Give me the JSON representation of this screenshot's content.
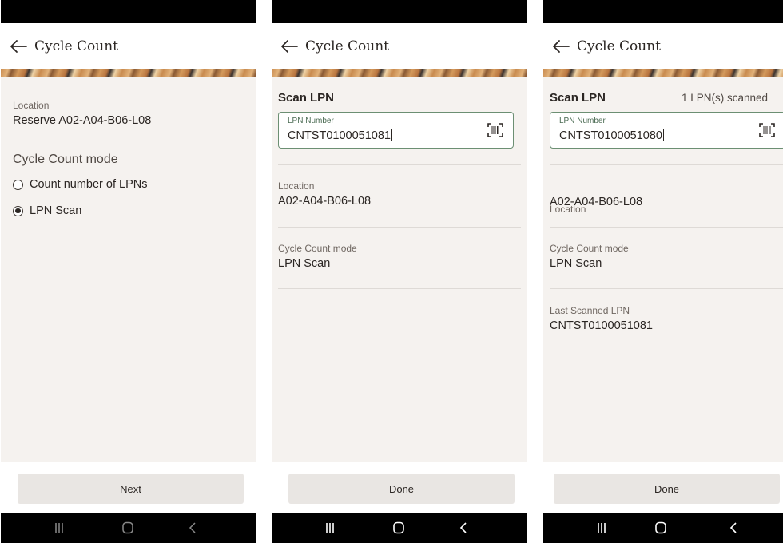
{
  "header": {
    "title": "Cycle Count"
  },
  "screens": {
    "mode_select": {
      "location_label": "Location",
      "location_value": "Reserve A02-A04-B06-L08",
      "mode_heading": "Cycle Count mode",
      "options": [
        {
          "label": "Count number of LPNs",
          "selected": false
        },
        {
          "label": "LPN Scan",
          "selected": true
        }
      ],
      "footer_button": "Next"
    },
    "scan_first": {
      "scan_title": "Scan LPN",
      "lpn_label": "LPN Number",
      "lpn_value": "CNTST0100051081",
      "location_label": "Location",
      "location_value": "A02-A04-B06-L08",
      "mode_label": "Cycle Count mode",
      "mode_value": "LPN Scan",
      "footer_button": "Done"
    },
    "scan_second": {
      "scan_title": "Scan LPN",
      "scan_count": "1 LPN(s) scanned",
      "lpn_label": "LPN Number",
      "lpn_value": "CNTST0100051080",
      "location_label": "Location",
      "location_value": "A02-A04-B06-L08",
      "mode_label": "Cycle Count mode",
      "mode_value": "LPN Scan",
      "last_label": "Last Scanned LPN",
      "last_value": "CNTST0100051081",
      "footer_button": "Done"
    }
  },
  "icons": {
    "back": "arrow-left-icon",
    "barcode": "barcode-scan-icon",
    "nav_recents": "recents-icon",
    "nav_home": "home-icon",
    "nav_back": "chevron-left-icon"
  },
  "colors": {
    "background": "#f5f2ef",
    "field_border": "#6c8f73",
    "button": "#e9e6e3",
    "system_bar": "#000000"
  }
}
